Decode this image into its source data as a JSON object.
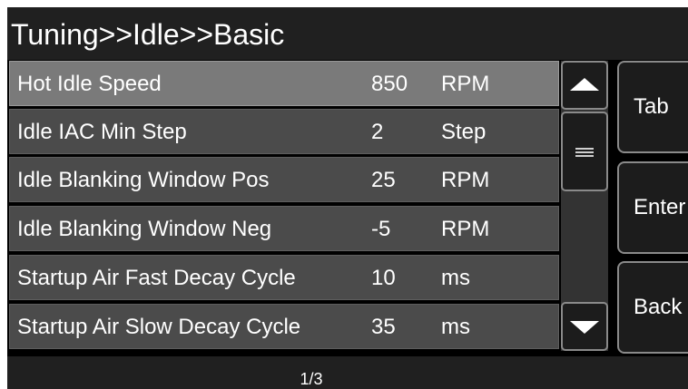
{
  "title": "Tuning>>Idle>>Basic",
  "rows": [
    {
      "label": "Hot Idle Speed",
      "value": "850",
      "unit": "RPM",
      "selected": true
    },
    {
      "label": "Idle IAC Min Step",
      "value": "2",
      "unit": "Step",
      "selected": false
    },
    {
      "label": "Idle Blanking Window Pos",
      "value": "25",
      "unit": "RPM",
      "selected": false
    },
    {
      "label": "Idle Blanking Window Neg",
      "value": "-5",
      "unit": "RPM",
      "selected": false
    },
    {
      "label": "Startup Air Fast Decay Cycle",
      "value": "10",
      "unit": "ms",
      "selected": false
    },
    {
      "label": "Startup Air Slow Decay Cycle",
      "value": "35",
      "unit": "ms",
      "selected": false
    }
  ],
  "buttons": {
    "tab": "Tab",
    "enter": "Enter",
    "back": "Back"
  },
  "scrollbar": {
    "up_icon": "triangle-up-icon",
    "down_icon": "triangle-down-icon",
    "thumb_icon": "grip-lines-icon",
    "position_fraction": 0.0
  },
  "footer": {
    "page": "1/3"
  },
  "colors": {
    "background": "#000000",
    "row": "#4b4b4b",
    "row_selected": "#7a7a7a",
    "text": "#ffffff",
    "button_border": "#8a8a8a"
  }
}
